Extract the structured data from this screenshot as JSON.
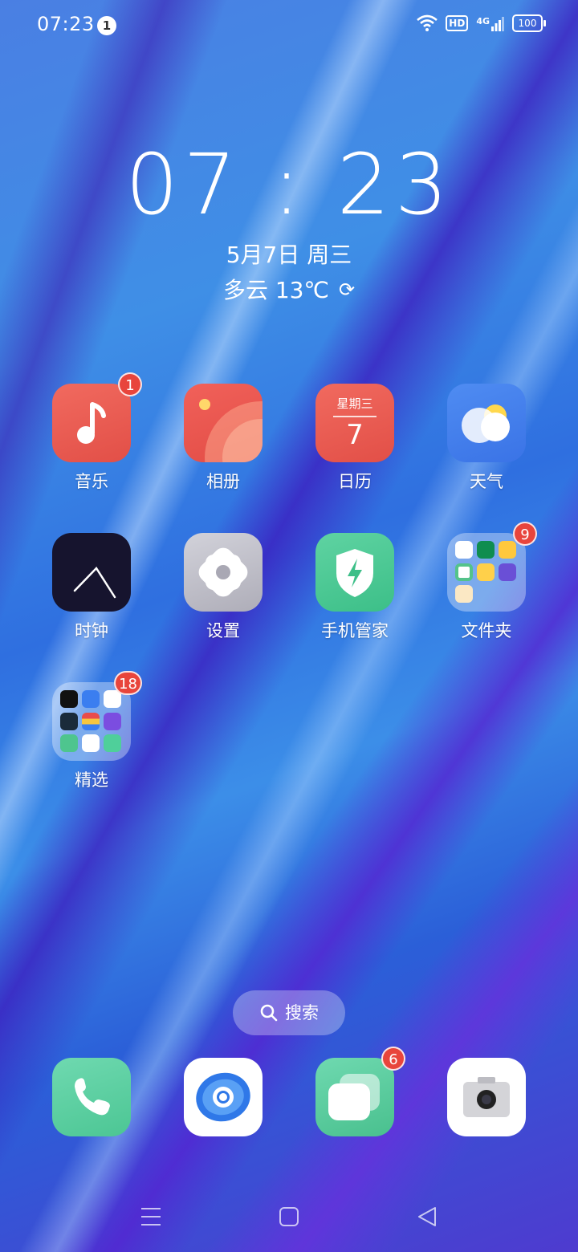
{
  "status_bar": {
    "time": "07:23",
    "notification_count": "1",
    "network": "4G",
    "hd": "HD",
    "battery": "100"
  },
  "lock_clock": {
    "time": "07 : 23",
    "date": "5月7日 周三",
    "weather": "多云 13℃"
  },
  "apps": [
    {
      "label": "音乐",
      "badge": "1",
      "icon": "music-note-icon"
    },
    {
      "label": "相册",
      "icon": "photo-album-icon"
    },
    {
      "label": "日历",
      "day_of_week": "星期三",
      "day": "7",
      "icon": "calendar-icon"
    },
    {
      "label": "天气",
      "icon": "weather-icon"
    },
    {
      "label": "时钟",
      "icon": "clock-icon"
    },
    {
      "label": "设置",
      "icon": "settings-icon"
    },
    {
      "label": "手机管家",
      "icon": "phone-manager-icon"
    },
    {
      "label": "文件夹",
      "badge": "9",
      "icon": "folder-icon"
    },
    {
      "label": "精选",
      "badge": "18",
      "icon": "folder-icon"
    }
  ],
  "search": {
    "label": "搜索"
  },
  "dock": [
    {
      "icon": "phone-icon"
    },
    {
      "icon": "browser-icon"
    },
    {
      "icon": "messages-icon",
      "badge": "6"
    },
    {
      "icon": "camera-icon"
    }
  ],
  "navbar": {
    "icons": [
      "menu-icon",
      "home-icon",
      "back-icon"
    ]
  },
  "colors": {
    "badge": "#e8453c",
    "accent": "#3a73e6"
  }
}
